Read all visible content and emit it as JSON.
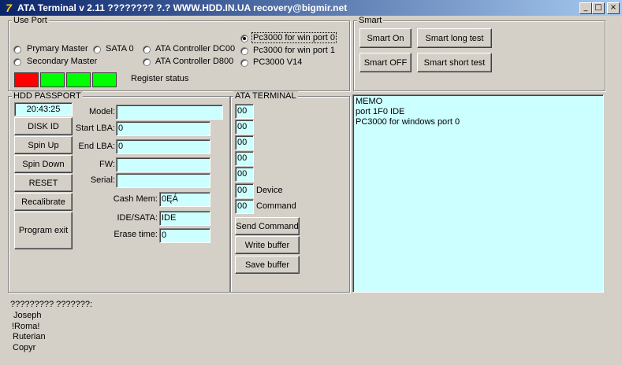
{
  "window": {
    "title": "ATA Terminal v 2.11 ???????? ?.? WWW.HDD.IN.UA recovery@bigmir.net",
    "icon": "7",
    "minimize_glyph": "_",
    "maximize_glyph": "□",
    "close_glyph": "×"
  },
  "use_port": {
    "legend": "Use Port",
    "options": {
      "primary_master": "Prymary Master",
      "secondary_master": "Secondary Master",
      "sata0": "SATA 0",
      "ata_dc00": "ATA Controller DC00",
      "ata_d800": "ATA Controller D800",
      "pc3000_port0": "Pc3000 for win port 0",
      "pc3000_port1": "Pc3000 for win port 1",
      "pc3000_v14": "PC3000 V14"
    },
    "selected": "pc3000_port0",
    "register_status_label": "Register status",
    "register_colors": [
      "#ff0000",
      "#00ff00",
      "#00ff00",
      "#00ff00"
    ]
  },
  "smart": {
    "legend": "Smart",
    "on": "Smart On",
    "off": "Smart OFF",
    "long_test": "Smart long test",
    "short_test": "Smart short test"
  },
  "passport": {
    "legend": "HDD PASSPORT",
    "time": "20:43:25",
    "buttons": {
      "disk_id": "DISK ID",
      "spin_up": "Spin Up",
      "spin_down": "Spin Down",
      "reset": "RESET",
      "recalibrate": "Recalibrate",
      "program_exit": "Program exit"
    },
    "fields": {
      "model_label": "Model:",
      "model": "",
      "start_lba_label": "Start LBA:",
      "start_lba": "0",
      "end_lba_label": "End LBA:",
      "end_lba": "0",
      "fw_label": "FW:",
      "fw": "",
      "serial_label": "Serial:",
      "serial": "",
      "cash_mem_label": "Cash Mem:",
      "cash_mem": "0ĘÁ",
      "ide_sata_label": "IDE/SATA:",
      "ide_sata": "IDE",
      "erase_time_label": "Erase time:",
      "erase_time": "0"
    }
  },
  "ata_terminal": {
    "legend": "ATA TERMINAL",
    "registers": [
      "00",
      "00",
      "00",
      "00",
      "00",
      "00",
      "00"
    ],
    "device_label": "Device",
    "command_label": "Command",
    "send_command": "Send Command",
    "write_buffer": "Write buffer",
    "save_buffer": "Save buffer"
  },
  "memo": [
    "MEMO",
    "port 1F0 IDE",
    "PC3000 for windows port 0"
  ],
  "credits": {
    "heading": "????????? ???????:",
    "names": [
      "Joseph",
      "!Roma!",
      "Ruterian",
      "Copyr"
    ]
  }
}
